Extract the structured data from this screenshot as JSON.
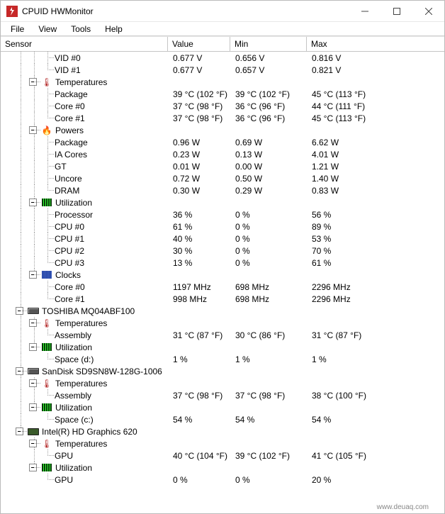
{
  "window": {
    "title": "CPUID HWMonitor"
  },
  "menu": {
    "file": "File",
    "view": "View",
    "tools": "Tools",
    "help": "Help"
  },
  "columns": {
    "sensor": "Sensor",
    "value": "Value",
    "min": "Min",
    "max": "Max"
  },
  "watermark": "www.deuaq.com",
  "tree": [
    {
      "lines": [
        "b",
        "v",
        "v",
        "t"
      ],
      "label": "VID #0",
      "v": "0.677 V",
      "min": "0.656 V",
      "max": "0.816 V"
    },
    {
      "lines": [
        "b",
        "v",
        "v",
        "l"
      ],
      "label": "VID #1",
      "v": "0.677 V",
      "min": "0.657 V",
      "max": "0.821 V"
    },
    {
      "lines": [
        "b",
        "v",
        "t"
      ],
      "exp": true,
      "icon": "temp",
      "label": "Temperatures"
    },
    {
      "lines": [
        "b",
        "v",
        "v",
        "t"
      ],
      "label": "Package",
      "v": "39 °C  (102 °F)",
      "min": "39 °C  (102 °F)",
      "max": "45 °C  (113 °F)"
    },
    {
      "lines": [
        "b",
        "v",
        "v",
        "t"
      ],
      "label": "Core #0",
      "v": "37 °C  (98 °F)",
      "min": "36 °C  (96 °F)",
      "max": "44 °C  (111 °F)"
    },
    {
      "lines": [
        "b",
        "v",
        "v",
        "l"
      ],
      "label": "Core #1",
      "v": "37 °C  (98 °F)",
      "min": "36 °C  (96 °F)",
      "max": "45 °C  (113 °F)"
    },
    {
      "lines": [
        "b",
        "v",
        "t"
      ],
      "exp": true,
      "icon": "power",
      "label": "Powers"
    },
    {
      "lines": [
        "b",
        "v",
        "v",
        "t"
      ],
      "label": "Package",
      "v": "0.96 W",
      "min": "0.69 W",
      "max": "6.62 W"
    },
    {
      "lines": [
        "b",
        "v",
        "v",
        "t"
      ],
      "label": "IA Cores",
      "v": "0.23 W",
      "min": "0.13 W",
      "max": "4.01 W"
    },
    {
      "lines": [
        "b",
        "v",
        "v",
        "t"
      ],
      "label": "GT",
      "v": "0.01 W",
      "min": "0.00 W",
      "max": "1.21 W"
    },
    {
      "lines": [
        "b",
        "v",
        "v",
        "t"
      ],
      "label": "Uncore",
      "v": "0.72 W",
      "min": "0.50 W",
      "max": "1.40 W"
    },
    {
      "lines": [
        "b",
        "v",
        "v",
        "l"
      ],
      "label": "DRAM",
      "v": "0.30 W",
      "min": "0.29 W",
      "max": "0.83 W"
    },
    {
      "lines": [
        "b",
        "v",
        "t"
      ],
      "exp": true,
      "icon": "util",
      "label": "Utilization"
    },
    {
      "lines": [
        "b",
        "v",
        "v",
        "t"
      ],
      "label": "Processor",
      "v": "36 %",
      "min": "0 %",
      "max": "56 %"
    },
    {
      "lines": [
        "b",
        "v",
        "v",
        "t"
      ],
      "label": "CPU #0",
      "v": "61 %",
      "min": "0 %",
      "max": "89 %"
    },
    {
      "lines": [
        "b",
        "v",
        "v",
        "t"
      ],
      "label": "CPU #1",
      "v": "40 %",
      "min": "0 %",
      "max": "53 %"
    },
    {
      "lines": [
        "b",
        "v",
        "v",
        "t"
      ],
      "label": "CPU #2",
      "v": "30 %",
      "min": "0 %",
      "max": "70 %"
    },
    {
      "lines": [
        "b",
        "v",
        "v",
        "l"
      ],
      "label": "CPU #3",
      "v": "13 %",
      "min": "0 %",
      "max": "61 %"
    },
    {
      "lines": [
        "b",
        "v",
        "l"
      ],
      "exp": true,
      "icon": "clock",
      "label": "Clocks"
    },
    {
      "lines": [
        "b",
        "v",
        "b",
        "t"
      ],
      "label": "Core #0",
      "v": "1197 MHz",
      "min": "698 MHz",
      "max": "2296 MHz"
    },
    {
      "lines": [
        "b",
        "v",
        "b",
        "l"
      ],
      "label": "Core #1",
      "v": "998 MHz",
      "min": "698 MHz",
      "max": "2296 MHz"
    },
    {
      "lines": [
        "b",
        "t"
      ],
      "exp": true,
      "icon": "drive",
      "label": "TOSHIBA MQ04ABF100"
    },
    {
      "lines": [
        "b",
        "v",
        "t"
      ],
      "exp": true,
      "icon": "temp",
      "label": "Temperatures"
    },
    {
      "lines": [
        "b",
        "v",
        "v",
        "l"
      ],
      "label": "Assembly",
      "v": "31 °C  (87 °F)",
      "min": "30 °C  (86 °F)",
      "max": "31 °C  (87 °F)"
    },
    {
      "lines": [
        "b",
        "v",
        "l"
      ],
      "exp": true,
      "icon": "util",
      "label": "Utilization"
    },
    {
      "lines": [
        "b",
        "v",
        "b",
        "l"
      ],
      "label": "Space (d:)",
      "v": "1 %",
      "min": "1 %",
      "max": "1 %"
    },
    {
      "lines": [
        "b",
        "t"
      ],
      "exp": true,
      "icon": "drive",
      "label": "SanDisk SD9SN8W-128G-1006"
    },
    {
      "lines": [
        "b",
        "v",
        "t"
      ],
      "exp": true,
      "icon": "temp",
      "label": "Temperatures"
    },
    {
      "lines": [
        "b",
        "v",
        "v",
        "l"
      ],
      "label": "Assembly",
      "v": "37 °C  (98 °F)",
      "min": "37 °C  (98 °F)",
      "max": "38 °C  (100 °F)"
    },
    {
      "lines": [
        "b",
        "v",
        "l"
      ],
      "exp": true,
      "icon": "util",
      "label": "Utilization"
    },
    {
      "lines": [
        "b",
        "v",
        "b",
        "l"
      ],
      "label": "Space (c:)",
      "v": "54 %",
      "min": "54 %",
      "max": "54 %"
    },
    {
      "lines": [
        "b",
        "l"
      ],
      "exp": true,
      "icon": "gpu",
      "label": "Intel(R) HD Graphics 620"
    },
    {
      "lines": [
        "b",
        "b",
        "t"
      ],
      "exp": true,
      "icon": "temp",
      "label": "Temperatures"
    },
    {
      "lines": [
        "b",
        "b",
        "v",
        "l"
      ],
      "label": "GPU",
      "v": "40 °C  (104 °F)",
      "min": "39 °C  (102 °F)",
      "max": "41 °C  (105 °F)"
    },
    {
      "lines": [
        "b",
        "b",
        "l"
      ],
      "exp": true,
      "icon": "util",
      "label": "Utilization"
    },
    {
      "lines": [
        "b",
        "b",
        "b",
        "l"
      ],
      "label": "GPU",
      "v": "0 %",
      "min": "0 %",
      "max": "20 %"
    }
  ]
}
